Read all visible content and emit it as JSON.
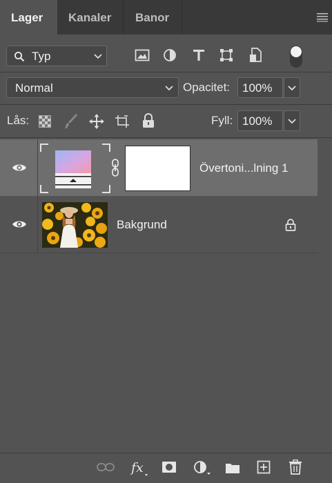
{
  "tabs": [
    {
      "label": "Lager",
      "active": true
    },
    {
      "label": "Kanaler",
      "active": false
    },
    {
      "label": "Banor",
      "active": false
    }
  ],
  "filter": {
    "label": "Typ"
  },
  "blend": {
    "mode": "Normal"
  },
  "opacity": {
    "label": "Opacitet:",
    "value": "100%"
  },
  "lock": {
    "label": "Lås:"
  },
  "fill": {
    "label": "Fyll:",
    "value": "100%"
  },
  "layers": [
    {
      "name": "Övertoni...lning 1",
      "selected": true,
      "visible": true,
      "type": "gradient-map-adjustment"
    },
    {
      "name": "Bakgrund",
      "selected": false,
      "visible": true,
      "locked": true,
      "type": "image"
    }
  ],
  "colors": {
    "panel": "#535353",
    "selected_row": "#6e6e6e",
    "tabbar": "#393939"
  }
}
